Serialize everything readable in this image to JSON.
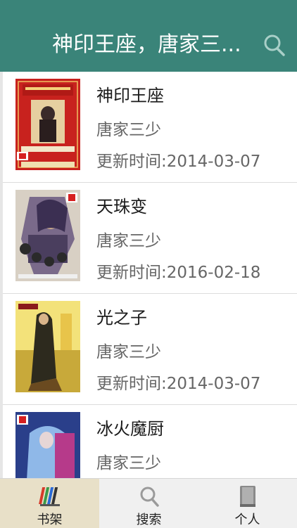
{
  "header": {
    "title": "神印王座，唐家三..."
  },
  "books": [
    {
      "title": "神印王座",
      "author": "唐家三少",
      "updated": "更新时间:2014-03-07"
    },
    {
      "title": "天珠变",
      "author": "唐家三少",
      "updated": "更新时间:2016-02-18"
    },
    {
      "title": "光之子",
      "author": "唐家三少",
      "updated": "更新时间:2014-03-07"
    },
    {
      "title": "冰火魔厨",
      "author": "唐家三少",
      "updated": ""
    }
  ],
  "tabbar": {
    "tabs": [
      {
        "label": "书架",
        "icon": "bookshelf-icon",
        "active": true
      },
      {
        "label": "搜索",
        "icon": "search-icon",
        "active": false
      },
      {
        "label": "个人",
        "icon": "book-icon",
        "active": false
      }
    ]
  },
  "colors": {
    "header_bg": "#3a8479",
    "active_tab_bg": "#e8e0c8"
  }
}
